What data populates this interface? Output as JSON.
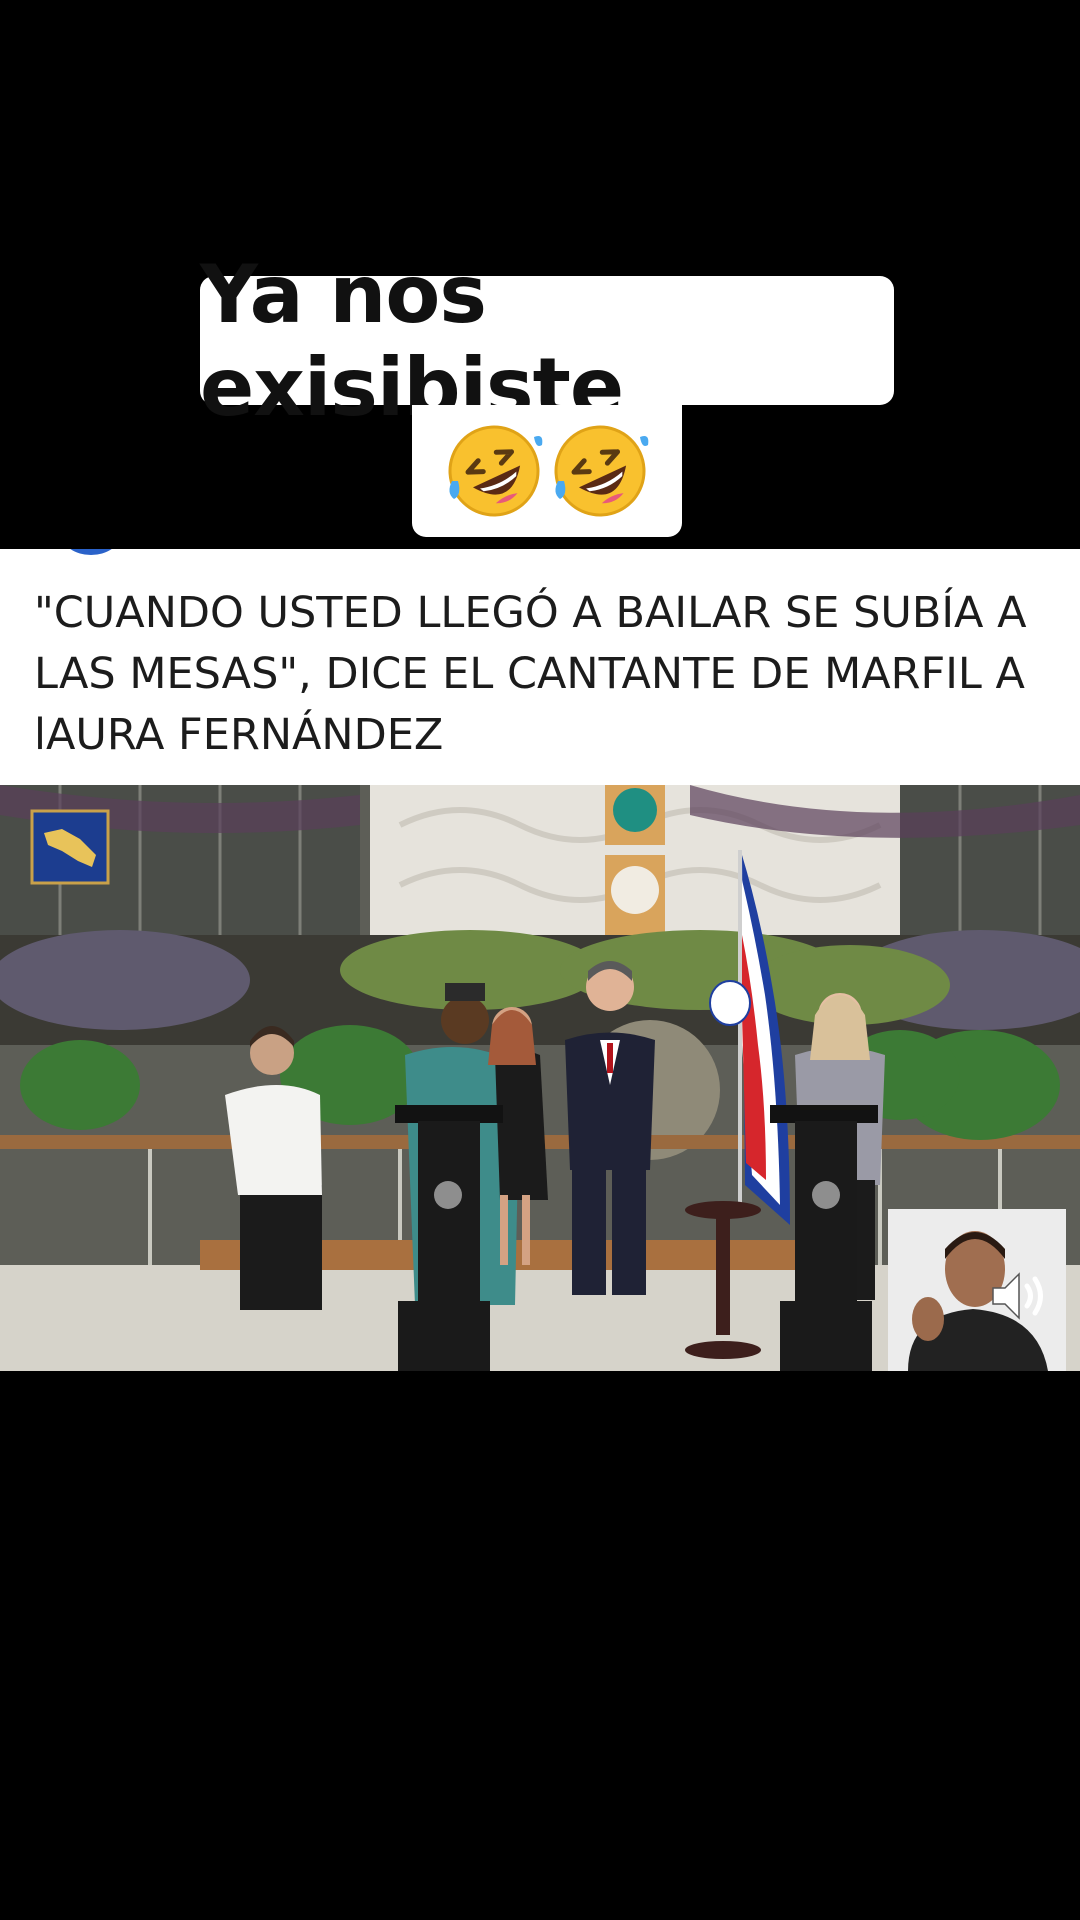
{
  "caption": {
    "line1": "Ya nos exisibiste",
    "emoji": [
      "rolling-on-floor-laughing-icon",
      "rolling-on-floor-laughing-icon"
    ]
  },
  "news_card": {
    "headline": "\"CUANDO USTED LLEGÓ A BAILAR SE SUBÍA A LAS MESAS\", DICE EL CANTANTE DE MARFIL A lAURA FERNÁNDEZ"
  },
  "colors": {
    "background": "#000000",
    "caption_bg": "#ffffff",
    "headline_text": "#1c1c1c",
    "flag_blue": "#1f3fa0",
    "flag_red": "#d6262c"
  },
  "video": {
    "scene_icons": [
      "costa-rica-map-icon",
      "costa-rica-flag-icon",
      "podium-icon"
    ]
  },
  "controls": {
    "volume_icon": "speaker-volume-icon"
  }
}
